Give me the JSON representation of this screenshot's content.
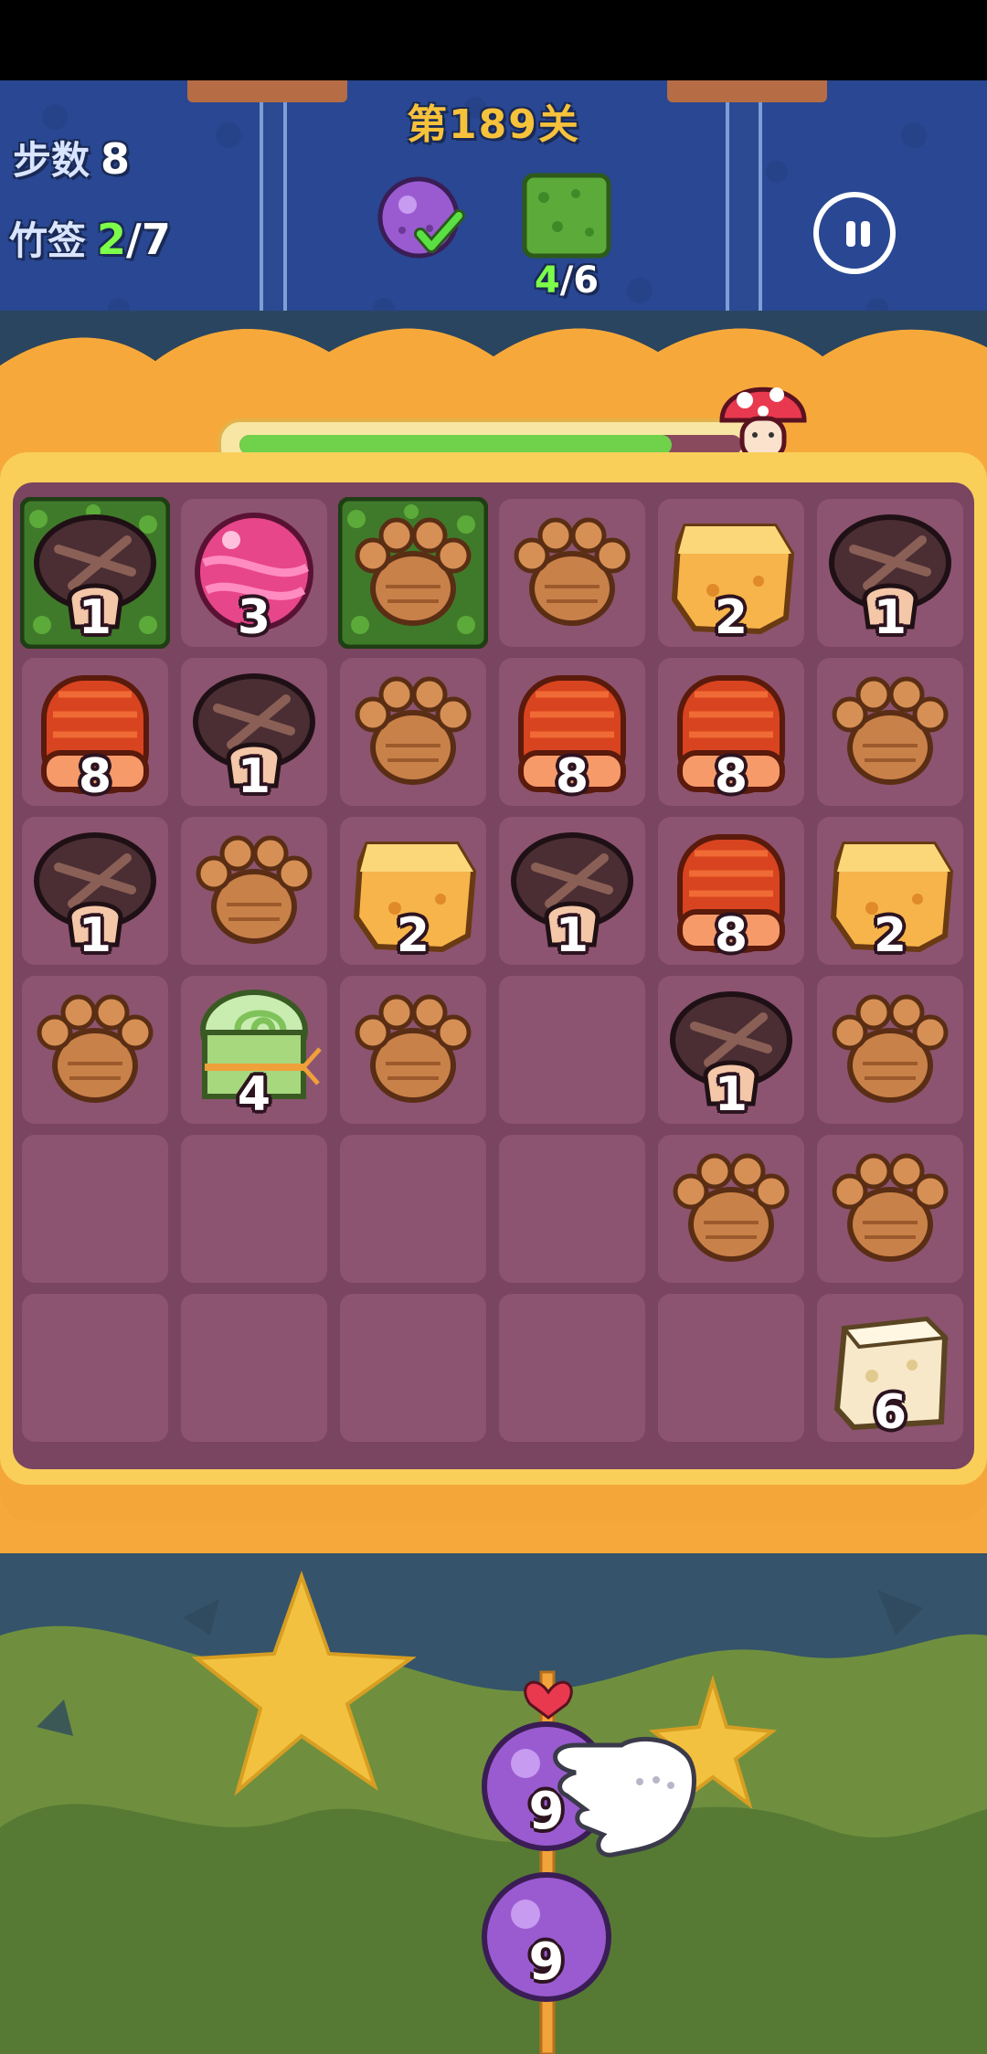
{
  "level": {
    "title": "第189关"
  },
  "stats": {
    "steps": {
      "label": "步数",
      "value": "8"
    },
    "skewers": {
      "label": "竹签",
      "current": "2",
      "total": "/7"
    }
  },
  "goals": [
    {
      "icon": "purple-berry-icon",
      "status": "done"
    },
    {
      "icon": "grass-tile-icon",
      "count_current": "4",
      "count_total": "/6"
    }
  ],
  "progress": {
    "fraction": 0.86,
    "marker_icon": "red-mushroom-icon"
  },
  "board": {
    "rows": 6,
    "cols": 6,
    "tiles": [
      [
        {
          "type": "mushroom",
          "n": "1",
          "grass": true
        },
        {
          "type": "candy",
          "n": "3"
        },
        {
          "type": "paw",
          "grass": true
        },
        {
          "type": "paw"
        },
        {
          "type": "cheese",
          "n": "2"
        },
        {
          "type": "mushroom",
          "n": "1"
        }
      ],
      [
        {
          "type": "salmon",
          "n": "8"
        },
        {
          "type": "mushroom",
          "n": "1"
        },
        {
          "type": "paw"
        },
        {
          "type": "salmon",
          "n": "8"
        },
        {
          "type": "salmon",
          "n": "8"
        },
        {
          "type": "paw"
        }
      ],
      [
        {
          "type": "mushroom",
          "n": "1"
        },
        {
          "type": "paw"
        },
        {
          "type": "cheese",
          "n": "2"
        },
        {
          "type": "mushroom",
          "n": "1"
        },
        {
          "type": "salmon",
          "n": "8"
        },
        {
          "type": "cheese",
          "n": "2"
        }
      ],
      [
        {
          "type": "paw"
        },
        {
          "type": "roll",
          "n": "4"
        },
        {
          "type": "paw"
        },
        null,
        {
          "type": "mushroom",
          "n": "1"
        },
        {
          "type": "paw"
        }
      ],
      [
        null,
        null,
        null,
        null,
        {
          "type": "paw"
        },
        {
          "type": "paw"
        }
      ],
      [
        null,
        null,
        null,
        null,
        null,
        {
          "type": "tofu",
          "n": "6"
        }
      ]
    ]
  },
  "skewer": {
    "top_icon": "heart-icon",
    "items": [
      {
        "type": "purple-berry",
        "n": "9"
      },
      {
        "type": "purple-berry",
        "n": "9"
      }
    ]
  },
  "hint": {
    "icon": "pointing-hand-icon"
  },
  "colors": {
    "hud_bg": "#2b4a92",
    "board_bg": "#7a4560",
    "cell_bg": "#8c5470",
    "frame": "#f9cf5a",
    "accent_green": "#7dff4a",
    "title_gold": "#f7c23b"
  }
}
